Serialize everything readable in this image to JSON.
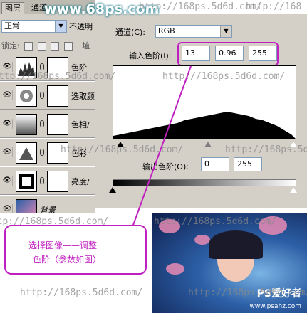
{
  "layers_panel": {
    "tabs": [
      "图层",
      "通道"
    ],
    "blend_mode": "正常",
    "opacity_label": "不透明",
    "lock_label": "锁定:",
    "fill_label": "埴",
    "layers": [
      {
        "name": "色阶"
      },
      {
        "name": "选取颜"
      },
      {
        "name": "色相/"
      },
      {
        "name": "色彩"
      },
      {
        "name": "亮度/"
      },
      {
        "name": "背景"
      }
    ]
  },
  "levels_dialog": {
    "channel_label": "通道(C):",
    "channel_value": "RGB",
    "input_label": "输入色阶(I):",
    "input_values": [
      "13",
      "0.96",
      "255"
    ],
    "output_label": "输出色阶(O):",
    "output_values": [
      "0",
      "255"
    ]
  },
  "callout": {
    "line1": "选择图像——调整",
    "line2": "——色阶（参数如图）"
  },
  "watermarks": {
    "site_top": "www.68ps.com",
    "url_a": "http://168ps.5d6d.com/",
    "url_b": "http://168",
    "url_c": "http://168ps.5d6d.com/",
    "url_d": "http://168ps.5d6d.com/",
    "url_e": "http://168ps.5d6d.com/",
    "url_f": "http://168ps.5d6d.com/",
    "url_g": "http://168ps.5d6d.com/",
    "url_h": "http://168ps.5d6d.com/",
    "url_i": "http://168ps.5d6d.com/",
    "url_j": "http://168ps.5d6d.com/",
    "photo_brand": "PS爱好者",
    "photo_url": "www.psahz.com"
  },
  "colors": {
    "callout_accent": "#c020c0",
    "panel_bg": "#d4d0c8"
  }
}
